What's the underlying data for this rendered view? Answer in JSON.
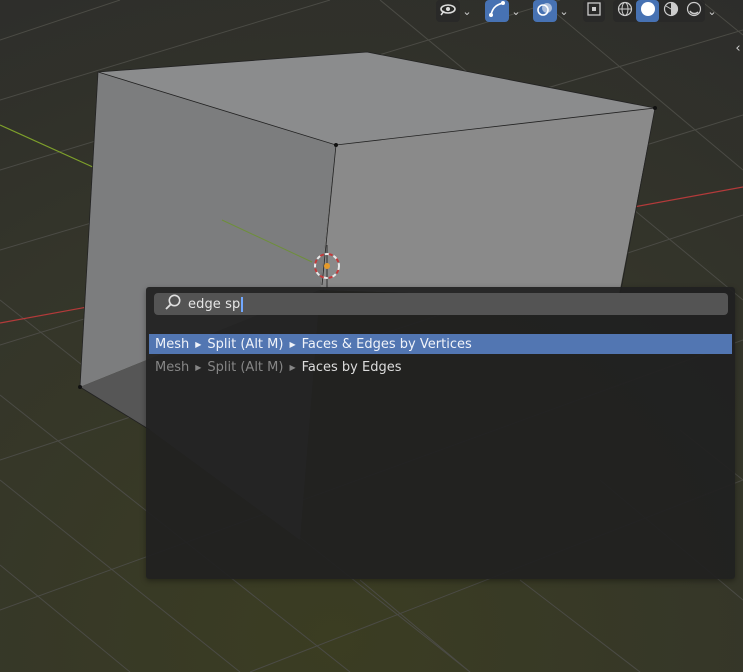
{
  "header": {
    "icons": [
      "visibility-icon",
      "gizmo-icon",
      "overlay-icon",
      "xray-icon",
      "wireframe-icon",
      "solid-icon",
      "material-preview-icon",
      "rendered-icon"
    ],
    "active_color": "#4772b3"
  },
  "search": {
    "query": "edge sp",
    "results": [
      {
        "path": [
          "Mesh",
          "Split (Alt M)"
        ],
        "item": "Faces & Edges by Vertices",
        "selected": true
      },
      {
        "path": [
          "Mesh",
          "Split (Alt M)"
        ],
        "item": "Faces by Edges",
        "selected": false
      }
    ],
    "highlight_color": "#5276b2"
  },
  "viewport": {
    "axis_x_color": "#b33a3a",
    "axis_y_color": "#7ea02a"
  }
}
